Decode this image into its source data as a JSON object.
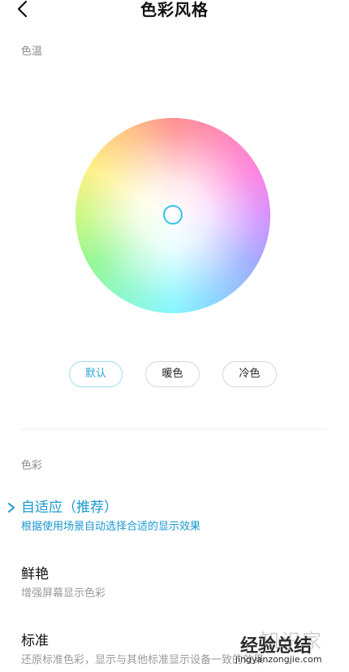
{
  "header": {
    "title": "色彩风格"
  },
  "color_temp": {
    "label": "色温",
    "presets": [
      {
        "label": "默认",
        "active": true
      },
      {
        "label": "暖色",
        "active": false
      },
      {
        "label": "冷色",
        "active": false
      }
    ]
  },
  "color": {
    "label": "色彩",
    "options": [
      {
        "title": "自适应（推荐）",
        "desc": "根据使用场景自动选择合适的显示效果",
        "selected": true
      },
      {
        "title": "鲜艳",
        "desc": "增强屏幕显示色彩",
        "selected": false
      },
      {
        "title": "标准",
        "desc": "还原标准色彩，显示与其他标准显示设备一致的效果",
        "selected": false
      }
    ]
  },
  "watermark": {
    "text_light": "知识家",
    "text_bold": "经验总结",
    "url": "jingyanzongjie.com"
  },
  "colors": {
    "accent": "#1a98d0",
    "cursor": "#2fc3ec"
  },
  "icons": {
    "back": "chevron-left-icon",
    "selected": "chevron-right-icon"
  }
}
